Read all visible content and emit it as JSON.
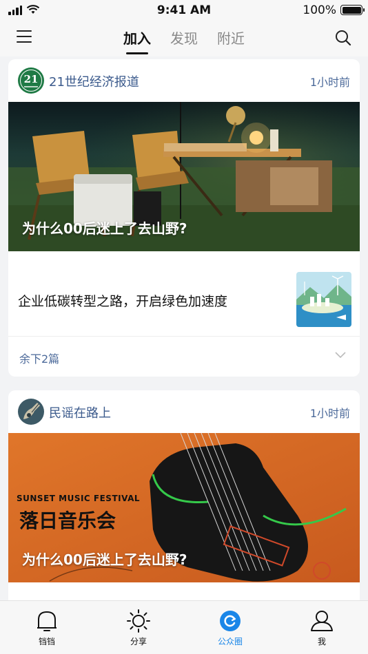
{
  "status_bar": {
    "time": "9:41 AM",
    "battery": "100%"
  },
  "nav": {
    "tabs": [
      {
        "label": "加入",
        "active": true
      },
      {
        "label": "发现",
        "active": false
      },
      {
        "label": "附近",
        "active": false
      }
    ],
    "menu_icon": "hamburger-menu-icon",
    "search_icon": "search-icon"
  },
  "cards": [
    {
      "account": "21世纪经济报道",
      "avatar_text": "21",
      "time_ago": "1小时前",
      "hero_caption": "为什么00后迷上了去山野?",
      "article_title": "企业低碳转型之路，开启绿色加速度",
      "more_label": "余下2篇"
    },
    {
      "account": "民谣在路上",
      "time_ago": "1小时前",
      "poster_title_en": "SUNSET MUSIC FESTIVAL",
      "poster_title_cn": "落日音乐会",
      "hero_caption": "为什么00后迷上了去山野?"
    }
  ],
  "tabbar": {
    "items": [
      {
        "label": "铛铛",
        "icon": "bell-icon",
        "active": false
      },
      {
        "label": "分享",
        "icon": "sun-icon",
        "active": false
      },
      {
        "label": "公众圈",
        "icon": "refresh-circle-icon",
        "active": true
      },
      {
        "label": "我",
        "icon": "person-icon",
        "active": false
      }
    ]
  },
  "colors": {
    "accent": "#1a86e8",
    "link": "#4c6a9a",
    "avatar_green": "#1f7a45"
  }
}
